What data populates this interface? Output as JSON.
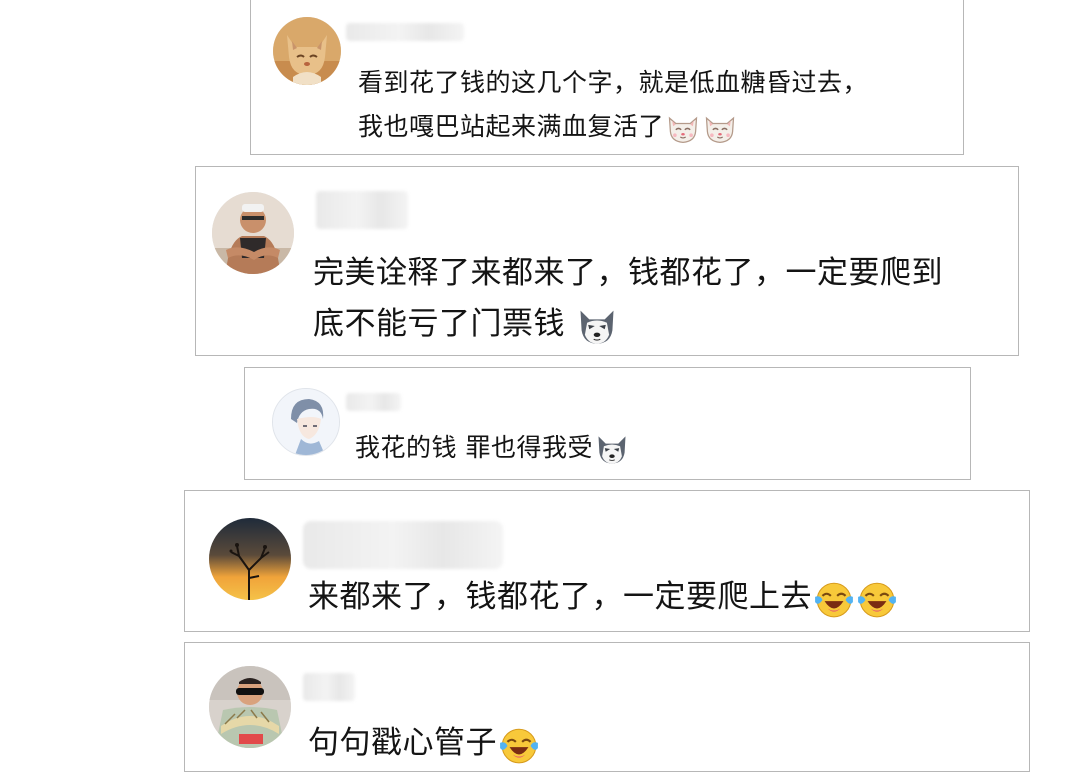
{
  "comments": [
    {
      "avatar_icon": "cat-avatar-icon",
      "username": "",
      "lines": [
        "看到花了钱的这几个字，就是低血糖昏过去，",
        "我也嘎巴站起来满血复活了"
      ],
      "emojis": [
        "cat-face-emoji",
        "cat-face-emoji"
      ]
    },
    {
      "avatar_icon": "muscle-man-avatar-icon",
      "username": "",
      "lines": [
        "完美诠释了来都来了，钱都花了，一定要爬到",
        "底不能亏了门票钱"
      ],
      "emojis": [
        "husky-dog-emoji"
      ]
    },
    {
      "avatar_icon": "anime-boy-avatar-icon",
      "username": "",
      "lines": [
        "我花的钱 罪也得我受"
      ],
      "emojis": [
        "husky-dog-emoji"
      ]
    },
    {
      "avatar_icon": "sunset-branch-avatar-icon",
      "username": "",
      "lines": [
        "来都来了，钱都花了，一定要爬上去"
      ],
      "emojis": [
        "crying-laughing-emoji",
        "crying-laughing-emoji"
      ]
    },
    {
      "avatar_icon": "sunglasses-money-avatar-icon",
      "username": "",
      "lines": [
        "句句戳心管子"
      ],
      "emojis": [
        "crying-laughing-emoji"
      ]
    }
  ]
}
